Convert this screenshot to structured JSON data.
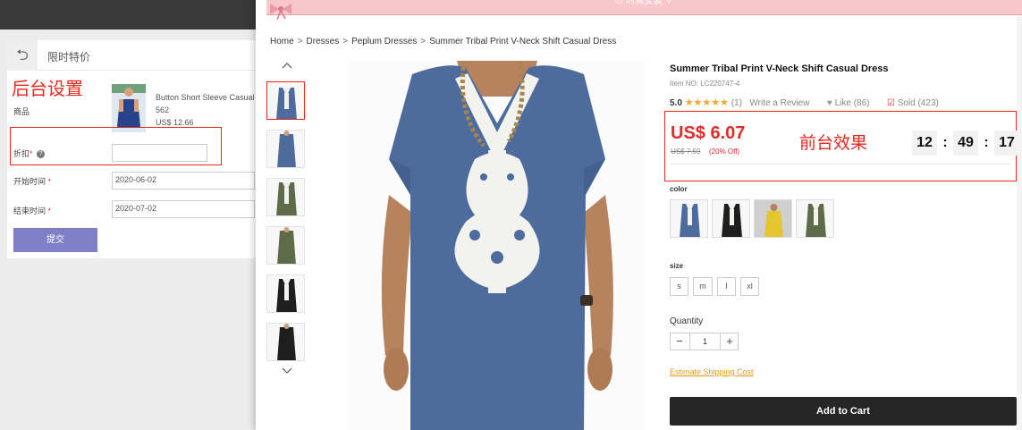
{
  "admin": {
    "back_icon": "undo-arrow-icon",
    "title": "限时特价",
    "annotation": "后台设置",
    "product_label": "商品",
    "product_name": "Button Short Sleeve Casual",
    "product_code": "562",
    "product_price": "US$ 12.66",
    "discount_label": "折扣",
    "discount_value": "",
    "start_label": "开始时间",
    "start_value": "2020-06-02",
    "end_label": "结束时间",
    "end_value": "2020-07-02",
    "required_mark": "*",
    "help_glyph": "?",
    "submit_label": "提交"
  },
  "store": {
    "banner_text": "⊙ 时尚女装 ∨",
    "breadcrumb": [
      "Home",
      "Dresses",
      "Peplum Dresses",
      "Summer Tribal Print V-Neck Shift Casual Dress"
    ],
    "breadcrumb_sep": ">",
    "product": {
      "title": "Summer Tribal Print V-Neck Shift Casual Dress",
      "item_no": "Item NO: LC220747-4",
      "rating": "5.0",
      "stars": "★★★★★",
      "reviews": "(1)",
      "write_review": "Write a Review",
      "like": "Like (86)",
      "sold": "Sold (423)"
    },
    "price": {
      "current": "US$ 6.07",
      "original": "US$ 7.59",
      "off": "(20% Off)",
      "annotation": "前台效果",
      "countdown": {
        "h": "12",
        "m": "49",
        "s": "17",
        "sep": ":"
      }
    },
    "color_label": "color",
    "sizes_label": "size",
    "sizes": [
      "s",
      "m",
      "l",
      "xl"
    ],
    "quantity_label": "Quantity",
    "quantity": "1",
    "qty_minus": "−",
    "qty_plus": "+",
    "shipping_link": "Estimate Shipping Cost",
    "add_to_cart": "Add to Cart",
    "colors": {
      "denim": "#4d6b9c",
      "black": "#1e1e1e",
      "yellow": "#e3c62c",
      "olive": "#5d6b48",
      "lace": "#f2f2ee",
      "accent_red": "#e32b2b",
      "annotation_red": "#e8281f"
    }
  }
}
